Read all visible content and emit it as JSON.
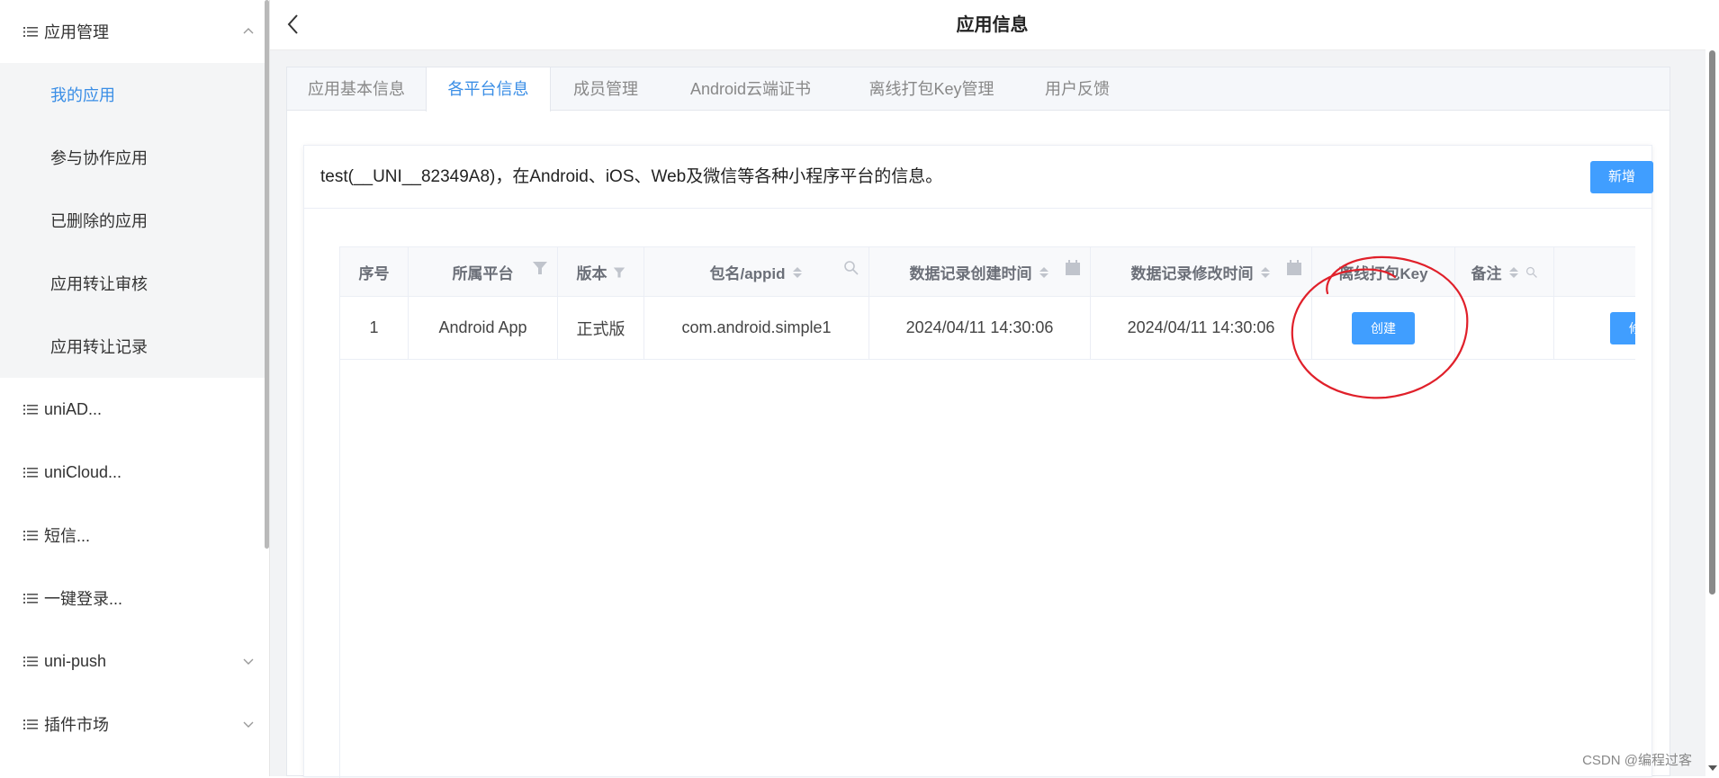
{
  "sidebar": {
    "groups": [
      {
        "label": "应用管理",
        "expanded": true
      },
      {
        "label": "uniAD..."
      },
      {
        "label": "uniCloud..."
      },
      {
        "label": "短信..."
      },
      {
        "label": "一键登录..."
      },
      {
        "label": "uni-push"
      },
      {
        "label": "插件市场"
      }
    ],
    "sub_items": [
      {
        "label": "我的应用",
        "active": true
      },
      {
        "label": "参与协作应用"
      },
      {
        "label": "已删除的应用"
      },
      {
        "label": "应用转让审核"
      },
      {
        "label": "应用转让记录"
      }
    ]
  },
  "header": {
    "title": "应用信息"
  },
  "tabs": [
    {
      "label": "应用基本信息"
    },
    {
      "label": "各平台信息",
      "active": true
    },
    {
      "label": "成员管理"
    },
    {
      "label": "Android云端证书"
    },
    {
      "label": "离线打包Key管理"
    },
    {
      "label": "用户反馈"
    }
  ],
  "panel": {
    "info_text": "test(__UNI__82349A8)，在Android、iOS、Web及微信等各种小程序平台的信息。",
    "add_button": "新增"
  },
  "table": {
    "columns": [
      {
        "label": "序号"
      },
      {
        "label": "所属平台"
      },
      {
        "label": "版本"
      },
      {
        "label": "包名/appid"
      },
      {
        "label": "数据记录创建时间"
      },
      {
        "label": "数据记录修改时间"
      },
      {
        "label": "离线打包Key"
      },
      {
        "label": "备注"
      },
      {
        "label": ""
      }
    ],
    "rows": [
      {
        "index": "1",
        "platform": "Android App",
        "version": "正式版",
        "package": "com.android.simple1",
        "created": "2024/04/11 14:30:06",
        "modified": "2024/04/11 14:30:06",
        "key_action": "创建",
        "remark": "",
        "edit_action": "修改"
      }
    ]
  },
  "watermark": "CSDN @编程过客",
  "colors": {
    "accent": "#409eff",
    "active_text": "#3a8ee6",
    "annotation": "#e0202a"
  }
}
